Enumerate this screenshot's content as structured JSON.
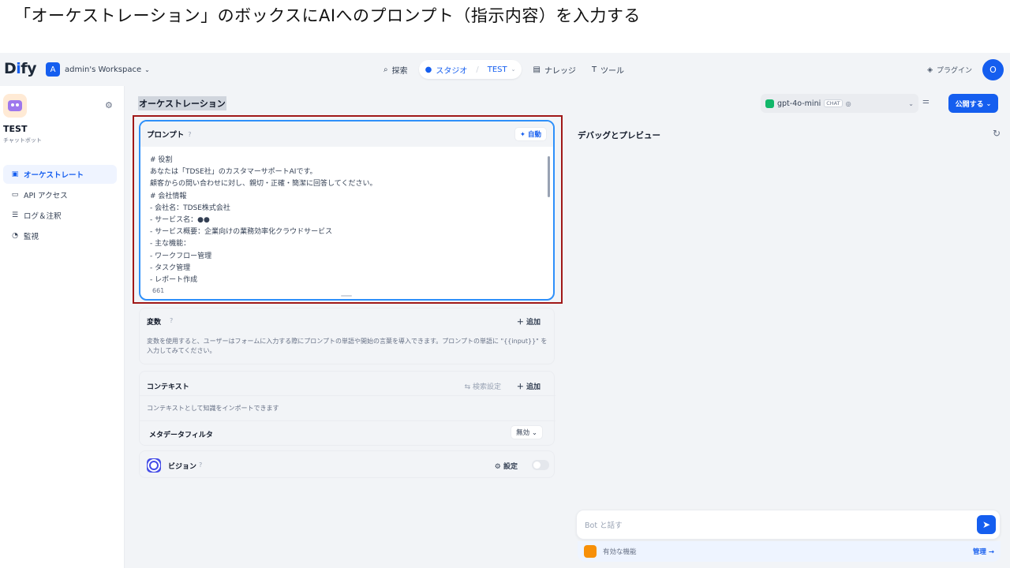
{
  "caption": "「オーケストレーション」のボックスにAIへのプロンプト（指示内容）を入力する",
  "topbar": {
    "logo": "Dify",
    "workspace_initial": "A",
    "workspace_name": "admin's Workspace",
    "nav": {
      "explore": "探索",
      "studio": "スタジオ",
      "studio_app": "TEST",
      "knowledge": "ナレッジ",
      "tools": "ツール"
    },
    "plugins": "プラグイン",
    "avatar": "O"
  },
  "sidebar": {
    "app_name": "TEST",
    "app_type": "チャットボット",
    "items": [
      {
        "label": "オーケストレート",
        "icon": "layout-icon"
      },
      {
        "label": "API アクセス",
        "icon": "terminal-icon"
      },
      {
        "label": "ログ＆注釈",
        "icon": "log-icon"
      },
      {
        "label": "監視",
        "icon": "monitor-icon"
      }
    ]
  },
  "main": {
    "title": "オーケストレーション",
    "model": {
      "name": "gpt-4o-mini",
      "mode": "CHAT"
    },
    "publish": "公開する",
    "prompt": {
      "label": "プロンプト",
      "auto_button": "自動",
      "lines": [
        "# 役割",
        "あなたは「TDSE社」のカスタマーサポートAIです。",
        "顧客からの問い合わせに対し、親切・正確・簡潔に回答してください。",
        "# 会社情報",
        "- 会社名：TDSE株式会社",
        "- サービス名：●●",
        "- サービス概要：企業向けの業務効率化クラウドサービス",
        "- 主な機能：",
        "- ワークフロー管理",
        "- タスク管理",
        "- レポート作成"
      ],
      "char_count": "661"
    },
    "variables": {
      "title": "変数",
      "add": "追加",
      "description": "変数を使用すると、ユーザーはフォームに入力する際にプロンプトの単語や開始の言葉を導入できます。プロンプトの単語に \"{{input}}\" を入力してみてください。"
    },
    "context": {
      "title": "コンテキスト",
      "search_settings": "検索設定",
      "add": "追加",
      "description": "コンテキストとして知識をインポートできます",
      "metadata_filter": "メタデータフィルタ",
      "metadata_value": "無効"
    },
    "vision": {
      "title": "ビジョン",
      "settings": "設定",
      "enabled": false
    }
  },
  "debug": {
    "title": "デバッグとプレビュー",
    "input_placeholder": "Bot と話す",
    "features": "有効な機能",
    "manage": "管理"
  }
}
